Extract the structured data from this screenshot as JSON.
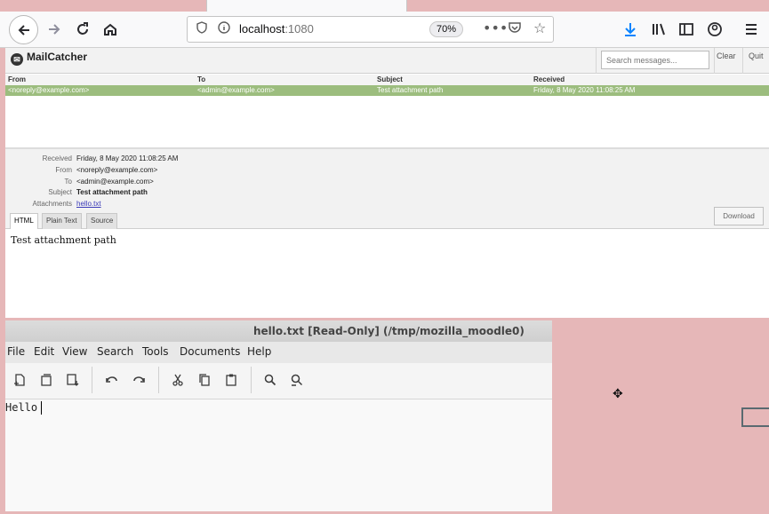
{
  "browser": {
    "url_host": "localhost",
    "url_port": ":1080",
    "zoom": "70%"
  },
  "mailcatcher": {
    "title": "MailCatcher",
    "search_placeholder": "Search messages...",
    "clear_label": "Clear",
    "quit_label": "Quit",
    "columns": [
      "From",
      "To",
      "Subject",
      "Received"
    ],
    "messages": [
      {
        "from": "<noreply@example.com>",
        "to": "<admin@example.com>",
        "subject": "Test attachment path",
        "received": "Friday, 8 May 2020 11:08:25 AM"
      }
    ],
    "detail": {
      "received_label": "Received",
      "received": "Friday, 8 May 2020 11:08:25 AM",
      "from_label": "From",
      "from": "<noreply@example.com>",
      "to_label": "To",
      "to": "<admin@example.com>",
      "subject_label": "Subject",
      "subject": "Test attachment path",
      "attachments_label": "Attachments",
      "attachment": "hello.txt"
    },
    "tabs": [
      "HTML",
      "Plain Text",
      "Source"
    ],
    "download_label": "Download",
    "body_text": "Test attachment path"
  },
  "gedit": {
    "title": "hello.txt [Read-Only] (/tmp/mozilla_moodle0)",
    "menu": [
      "File",
      "Edit",
      "View",
      "Search",
      "Tools",
      "Documents",
      "Help"
    ],
    "content": "Hello"
  }
}
